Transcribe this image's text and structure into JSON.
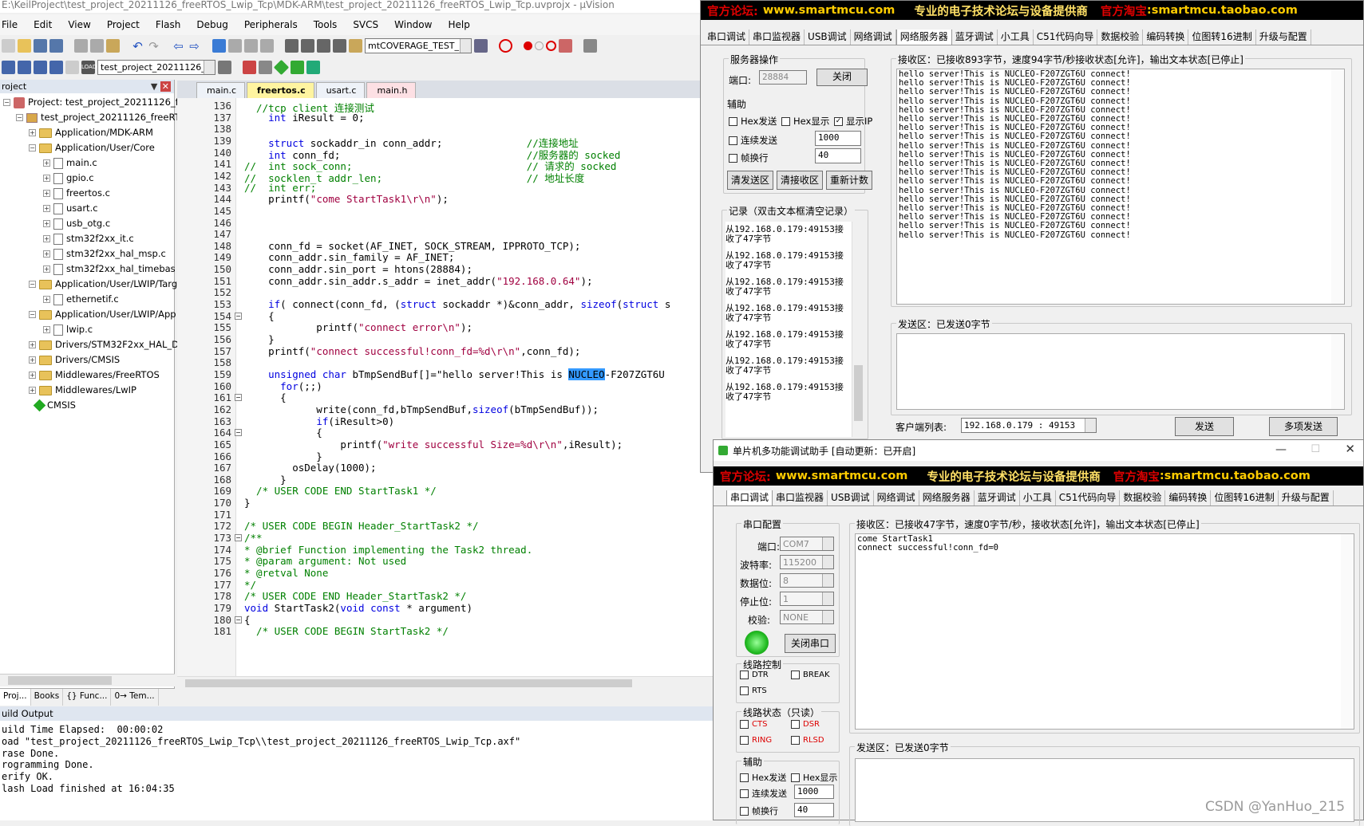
{
  "keil": {
    "title": "E:\\KeilProject\\test_project_20211126_freeRTOS_Lwip_Tcp\\MDK-ARM\\test_project_20211126_freeRTOS_Lwip_Tcp.uvprojx - µVision",
    "menu": [
      "File",
      "Edit",
      "View",
      "Project",
      "Flash",
      "Debug",
      "Peripherals",
      "Tools",
      "SVCS",
      "Window",
      "Help"
    ],
    "toolbar_combo1": "mtCOVERAGE_TEST_MAR",
    "toolbar_combo2": "test_project_20211126_fr",
    "project_panel": {
      "title": "roject",
      "tree": [
        "Project: test_project_20211126_free",
        "test_project_20211126_freeRTOS",
        "Application/MDK-ARM",
        "Application/User/Core",
        "main.c",
        "gpio.c",
        "freertos.c",
        "usart.c",
        "usb_otg.c",
        "stm32f2xx_it.c",
        "stm32f2xx_hal_msp.c",
        "stm32f2xx_hal_timebas",
        "Application/User/LWIP/Targ",
        "ethernetif.c",
        "Application/User/LWIP/App",
        "lwip.c",
        "Drivers/STM32F2xx_HAL_Dr",
        "Drivers/CMSIS",
        "Middlewares/FreeRTOS",
        "Middlewares/LwIP",
        "CMSIS"
      ],
      "tabs": [
        "Proj...",
        "Books",
        "{} Func...",
        "0→ Tem..."
      ]
    },
    "editor_tabs": [
      "main.c",
      "freertos.c",
      "usart.c",
      "main.h"
    ],
    "code_lines": [
      {
        "n": "136",
        "t": "  //tcp client 连接测试",
        "c": "cm"
      },
      {
        "n": "137",
        "t": "    int iResult = 0;",
        "c": ""
      },
      {
        "n": "138",
        "t": "",
        "c": ""
      },
      {
        "n": "139",
        "t": "    struct sockaddr_in conn_addr;              //连接地址",
        "c": ""
      },
      {
        "n": "140",
        "t": "    int conn_fd;                               //服务器的 socked",
        "c": ""
      },
      {
        "n": "141",
        "t": "//  int sock_conn;                             // 请求的 socked",
        "c": "cm"
      },
      {
        "n": "142",
        "t": "//  socklen_t addr_len;                        // 地址长度",
        "c": "cm"
      },
      {
        "n": "143",
        "t": "//  int err;",
        "c": "cm"
      },
      {
        "n": "144",
        "t": "    printf(\"come StartTask1\\r\\n\");",
        "c": ""
      },
      {
        "n": "145",
        "t": "",
        "c": ""
      },
      {
        "n": "146",
        "t": "",
        "c": ""
      },
      {
        "n": "147",
        "t": "",
        "c": ""
      },
      {
        "n": "148",
        "t": "    conn_fd = socket(AF_INET, SOCK_STREAM, IPPROTO_TCP);",
        "c": ""
      },
      {
        "n": "149",
        "t": "    conn_addr.sin_family = AF_INET;",
        "c": ""
      },
      {
        "n": "150",
        "t": "    conn_addr.sin_port = htons(28884);",
        "c": ""
      },
      {
        "n": "151",
        "t": "    conn_addr.sin_addr.s_addr = inet_addr(\"192.168.0.64\");",
        "c": ""
      },
      {
        "n": "152",
        "t": "",
        "c": ""
      },
      {
        "n": "153",
        "t": "    if( connect(conn_fd, (struct sockaddr *)&conn_addr, sizeof(struct s",
        "c": ""
      },
      {
        "n": "154",
        "t": "    {",
        "c": ""
      },
      {
        "n": "155",
        "t": "            printf(\"connect error\\n\");",
        "c": ""
      },
      {
        "n": "156",
        "t": "    }",
        "c": ""
      },
      {
        "n": "157",
        "t": "    printf(\"connect successful!conn_fd=%d\\r\\n\",conn_fd);",
        "c": ""
      },
      {
        "n": "158",
        "t": "",
        "c": ""
      },
      {
        "n": "159",
        "t": "    unsigned char bTmpSendBuf[]=\"hello server!This is NUCLEO-F207ZGT6U",
        "c": ""
      },
      {
        "n": "160",
        "t": "      for(;;)",
        "c": ""
      },
      {
        "n": "161",
        "t": "      {",
        "c": ""
      },
      {
        "n": "162",
        "t": "            write(conn_fd,bTmpSendBuf,sizeof(bTmpSendBuf));",
        "c": ""
      },
      {
        "n": "163",
        "t": "            if(iResult>0)",
        "c": ""
      },
      {
        "n": "164",
        "t": "            {",
        "c": ""
      },
      {
        "n": "165",
        "t": "                printf(\"write successful Size=%d\\r\\n\",iResult);",
        "c": ""
      },
      {
        "n": "166",
        "t": "            }",
        "c": ""
      },
      {
        "n": "167",
        "t": "        osDelay(1000);",
        "c": ""
      },
      {
        "n": "168",
        "t": "      }",
        "c": ""
      },
      {
        "n": "169",
        "t": "  /* USER CODE END StartTask1 */",
        "c": "cm"
      },
      {
        "n": "170",
        "t": "}",
        "c": ""
      },
      {
        "n": "171",
        "t": "",
        "c": ""
      },
      {
        "n": "172",
        "t": "/* USER CODE BEGIN Header_StartTask2 */",
        "c": "cm"
      },
      {
        "n": "173",
        "t": "/**",
        "c": "cm"
      },
      {
        "n": "174",
        "t": "* @brief Function implementing the Task2 thread.",
        "c": "cm"
      },
      {
        "n": "175",
        "t": "* @param argument: Not used",
        "c": "cm"
      },
      {
        "n": "176",
        "t": "* @retval None",
        "c": "cm"
      },
      {
        "n": "177",
        "t": "*/",
        "c": "cm"
      },
      {
        "n": "178",
        "t": "/* USER CODE END Header_StartTask2 */",
        "c": "cm"
      },
      {
        "n": "179",
        "t": "void StartTask2(void const * argument)",
        "c": ""
      },
      {
        "n": "180",
        "t": "{",
        "c": ""
      },
      {
        "n": "181",
        "t": "  /* USER CODE BEGIN StartTask2 */",
        "c": "cm"
      }
    ],
    "build": {
      "title": "uild Output",
      "lines": [
        "uild Time Elapsed:  00:00:02",
        "oad \"test_project_20211126_freeRTOS_Lwip_Tcp\\\\test_project_20211126_freeRTOS_Lwip_Tcp.axf\"",
        "rase Done.",
        "rogramming Done.",
        "erify OK.",
        "lash Load finished at 16:04:35"
      ]
    }
  },
  "banner": {
    "forum_label": "官方论坛:",
    "forum_url": "www.smartmcu.com",
    "slogan": "专业的电子技术论坛与设备提供商",
    "shop_label": "官方淘宝",
    "shop_url": ":smartmcu.taobao.com"
  },
  "helper_tabs": [
    "串口调试",
    "串口监视器",
    "USB调试",
    "网络调试",
    "网络服务器",
    "蓝牙调试",
    "小工具",
    "C51代码向导",
    "数据校验",
    "编码转换",
    "位图转16进制",
    "升级与配置"
  ],
  "server_win": {
    "ops_title": "服务器操作",
    "port_label": "端口:",
    "port_value": "28884",
    "close_btn": "关闭",
    "aux_title": "辅助",
    "hex_send": "Hex发送",
    "hex_show": "Hex显示",
    "show_ip": "显示IP",
    "cont_send": "连续发送",
    "cont_value": "1000",
    "frame": "帧换行",
    "frame_value": "40",
    "clear_send": "清发送区",
    "clear_recv": "清接收区",
    "recount": "重新计数",
    "log_title": "记录（双击文本框清空记录）",
    "log_entries": [
      "从192.168.0.179:49153接收了47字节",
      "从192.168.0.179:49153接收了47字节",
      "从192.168.0.179:49153接收了47字节",
      "从192.168.0.179:49153接收了47字节",
      "从192.168.0.179:49153接收了47字节",
      "从192.168.0.179:49153接收了47字节",
      "从192.168.0.179:49153接收了47字节"
    ],
    "recv_title": "接收区：已接收893字节，速度94字节/秒接收状态[允许]，输出文本状态[已停止]",
    "recv_line": "hello server!This is NUCLEO-F207ZGT6U connect!",
    "recv_count": 19,
    "send_title": "发送区：已发送0字节",
    "client_label": "客户端列表:",
    "client_value": "192.168.0.179 : 49153",
    "send_btn": "发送",
    "multi_btn": "多项发送"
  },
  "serial_win": {
    "title": "单片机多功能调试助手 [自动更新：已开启]",
    "cfg_title": "串口配置",
    "port_label": "端口:",
    "port_value": "COM7",
    "baud_label": "波特率:",
    "baud_value": "115200",
    "data_label": "数据位:",
    "data_value": "8",
    "stop_label": "停止位:",
    "stop_value": "1",
    "parity_label": "校验:",
    "parity_value": "NONE",
    "close_port": "关闭串口",
    "line_ctrl": "线路控制",
    "dtr": "DTR",
    "break": "BREAK",
    "rts": "RTS",
    "line_status": "线路状态（只读）",
    "cts": "CTS",
    "dsr": "DSR",
    "ring": "RING",
    "rlsd": "RLSD",
    "aux_title": "辅助",
    "hex_send": "Hex发送",
    "hex_show": "Hex显示",
    "cont_send": "连续发送",
    "cont_value": "1000",
    "frame": "帧换行",
    "frame_value": "40",
    "recv_title": "接收区：已接收47字节，速度0字节/秒，接收状态[允许]，输出文本状态[已停止]",
    "recv_text": "come StartTask1\nconnect successful!conn_fd=0",
    "send_title": "发送区：已发送0字节"
  },
  "watermark": "CSDN @YanHuo_215",
  "colors": {
    "accent_red": "#e00000",
    "keyword": "#0000e0",
    "comment": "#008000",
    "string": "#a00040"
  }
}
